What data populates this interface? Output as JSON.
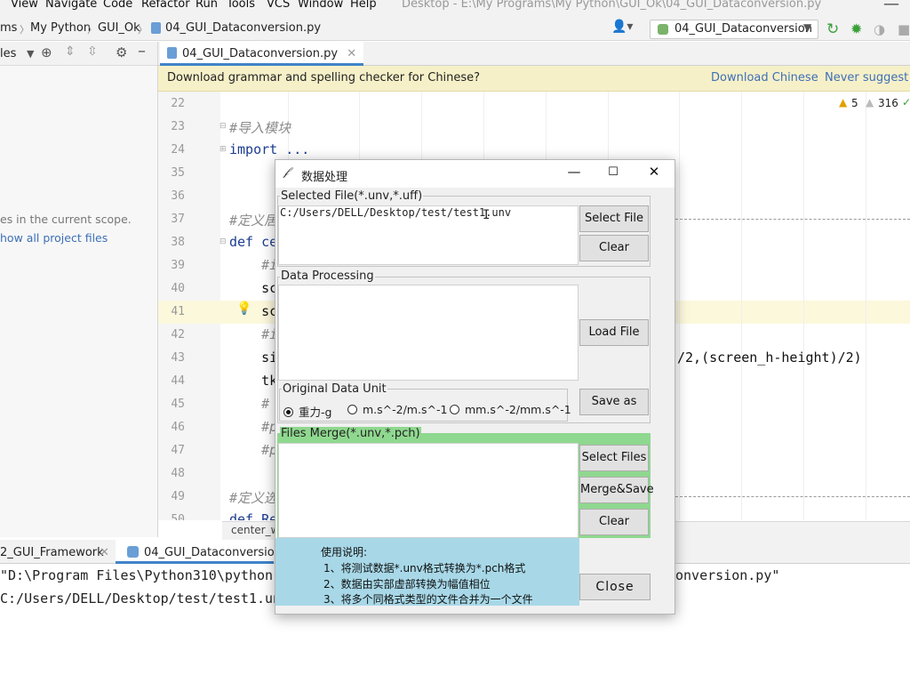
{
  "menu": {
    "items": [
      "View",
      "Navigate",
      "Code",
      "Refactor",
      "Run",
      "Tools",
      "VCS",
      "Window",
      "Help"
    ]
  },
  "window_title": "Desktop - E:\\My Programs\\My Python\\GUI_Ok\\04_GUI_Dataconversion.py",
  "breadcrumb": [
    "ms",
    "My Python",
    "GUI_Ok",
    "04_GUI_Dataconversion.py"
  ],
  "run_config": "04_GUI_Dataconversion",
  "project_panel": {
    "title": "les",
    "hint1": "es in the current scope.",
    "hint2": "how all project files"
  },
  "editor_tab": "04_GUI_Dataconversion.py",
  "banner": {
    "message": "Download grammar and spelling checker for Chinese?",
    "action1": "Download Chinese",
    "action2": "Never suggest C"
  },
  "inspections": {
    "warnings": "5",
    "weak_warnings": "316"
  },
  "code_lines": [
    {
      "num": "22",
      "text": ""
    },
    {
      "num": "23",
      "text": "#导入模块"
    },
    {
      "num": "24",
      "text": "import ..."
    },
    {
      "num": "35",
      "text": ""
    },
    {
      "num": "36",
      "text": ""
    },
    {
      "num": "37",
      "text": "#定义居"
    },
    {
      "num": "38",
      "text": "def ce"
    },
    {
      "num": "39",
      "text": "    #i"
    },
    {
      "num": "40",
      "text": "    sc"
    },
    {
      "num": "41",
      "text": "    sc"
    },
    {
      "num": "42",
      "text": "    #i"
    },
    {
      "num": "43",
      "text": "    si"
    },
    {
      "num": "44",
      "text": "    tk"
    },
    {
      "num": "45",
      "text": "    #"
    },
    {
      "num": "46",
      "text": "    #p"
    },
    {
      "num": "47",
      "text": "    #p"
    },
    {
      "num": "48",
      "text": ""
    },
    {
      "num": "49",
      "text": "#定义选"
    },
    {
      "num": "50",
      "text": "def Re"
    }
  ],
  "code_tail_43": "/2,(screen_h-height)/2)",
  "status_path": "center_w",
  "run_tabs": [
    "2_GUI_Framework",
    "04_GUI_Dataconversion"
  ],
  "console": {
    "line1": "\"D:\\Program Files\\Python310\\python.",
    "line1_tail": "onversion.py\"",
    "line2": "C:/Users/DELL/Desktop/test/test1.un"
  },
  "dialog": {
    "title": "数据处理",
    "selected_file": {
      "label": "Selected File(*.unv,*.uff)",
      "value": "C:/Users/DELL/Desktop/test/test1.unv",
      "select_button": "Select File",
      "clear_button": "Clear"
    },
    "data_processing": {
      "label": "Data Processing",
      "load_button": "Load File",
      "unit_label": "Original Data Unit",
      "units": [
        "重力-g",
        "m.s^-2/m.s^-1",
        "mm.s^-2/mm.s^-1"
      ],
      "selected_unit": "重力-g",
      "save_button": "Save as"
    },
    "files_merge": {
      "label": "Files Merge(*.unv,*.pch)",
      "select_button": "Select Files",
      "merge_button": "Merge&Save",
      "clear_button": "Clear"
    },
    "instructions": [
      "使用说明:",
      "1、将测试数据*.unv格式转换为*.pch格式",
      "2、数据由实部虚部转换为幅值相位",
      "3、将多个同格式类型的文件合并为一个文件"
    ],
    "close_button": "Close"
  },
  "colors": {
    "banner_bg": "#f6f0c8",
    "link": "#3d6fb7",
    "merge_group": "#8fd88f",
    "instructions_bg": "#a8d8e8",
    "active_tab_underline": "#4083c9"
  }
}
